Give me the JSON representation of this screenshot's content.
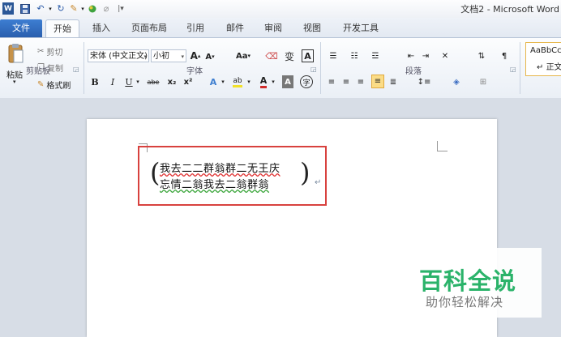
{
  "titlebar": {
    "title": "文档2 - Microsoft Word",
    "qat_icons": [
      "word-logo-icon",
      "save-icon",
      "undo-icon",
      "redo-icon",
      "format-painter-icon",
      "color-icon",
      "clear-icon",
      "customize-icon"
    ]
  },
  "tabs": {
    "file": "文件",
    "home": "开始",
    "insert": "插入",
    "layout": "页面布局",
    "references": "引用",
    "mailings": "邮件",
    "review": "审阅",
    "view": "视图",
    "developer": "开发工具"
  },
  "clipboard": {
    "paste": "粘贴",
    "cut": "剪切",
    "copy": "复制",
    "format_painter": "格式刷",
    "label": "剪贴板"
  },
  "font": {
    "family": "宋体 (中文正文)",
    "size": "小初",
    "grow": "A",
    "shrink": "A",
    "case": "Aa",
    "pinyin": "变",
    "border_char": "A",
    "bold": "B",
    "italic": "I",
    "underline": "U",
    "strike": "abe",
    "subscript": "x₂",
    "superscript": "x²",
    "effects": "A",
    "highlight": "ab",
    "color": "A",
    "shade": "A",
    "enclose": "字",
    "label": "字体"
  },
  "paragraph": {
    "label": "段落"
  },
  "styles": {
    "sample": "AaBbCc",
    "name": "正文"
  },
  "document": {
    "line1": "我去二二群翁群二无王庆",
    "line2": "忘情二翁我去二翁群翁"
  },
  "watermark": {
    "title": "百科全说",
    "subtitle": "助你轻松解决"
  }
}
